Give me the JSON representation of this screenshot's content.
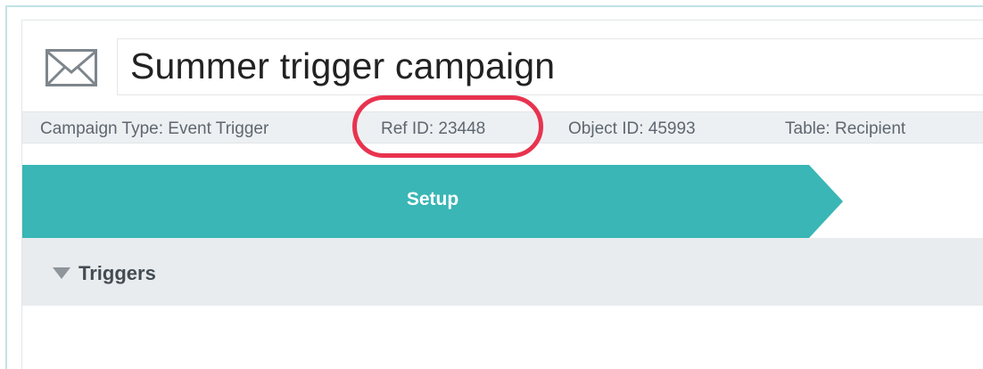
{
  "campaign": {
    "title": "Summer trigger campaign",
    "icon": "envelope-icon"
  },
  "meta": {
    "campaign_type": "Campaign Type: Event Trigger",
    "ref_id": "Ref ID: 23448",
    "object_id": "Object ID: 45993",
    "table": "Table: Recipient"
  },
  "highlight": {
    "target": "Ref ID: 23448",
    "color": "#e8334f"
  },
  "steps": [
    {
      "label": "Setup",
      "color": "#39b6b5",
      "active": true
    }
  ],
  "sections": [
    {
      "label": "Triggers",
      "expanded": true
    }
  ],
  "colors": {
    "accent": "#39b6b5",
    "highlight": "#e8334f",
    "meta_bar": "#edf0f2",
    "section_bar": "#e9ecee"
  }
}
